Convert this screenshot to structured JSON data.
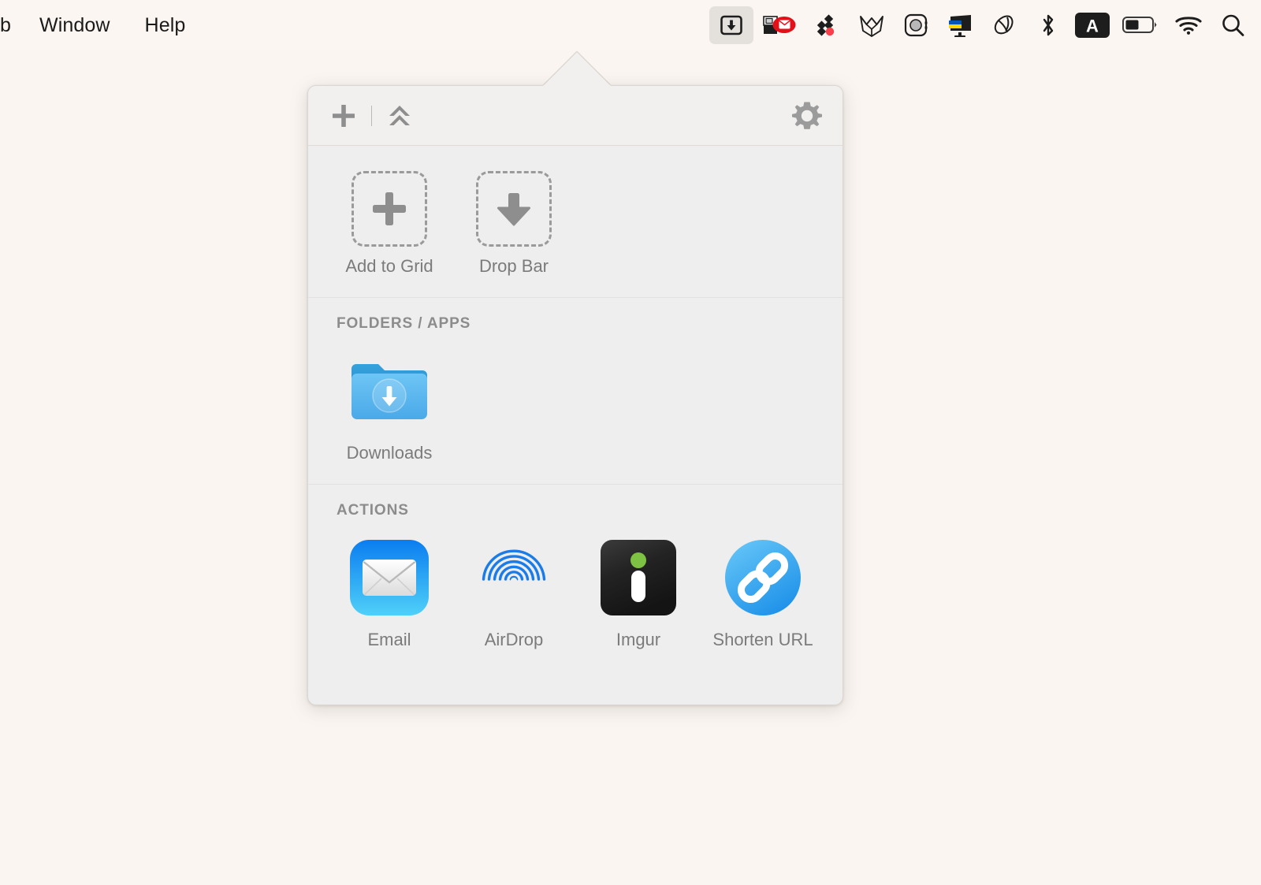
{
  "desktop": {
    "background_color": "#faf5f1"
  },
  "menubar": {
    "background_color": "#fbf6f2",
    "app_menus": [
      {
        "label": "b",
        "name": "menu-clipped",
        "clipped": true
      },
      {
        "label": "Window",
        "name": "menu-window",
        "clipped": false
      },
      {
        "label": "Help",
        "name": "menu-help",
        "clipped": false
      }
    ],
    "status_items": [
      {
        "name": "dropzone-menubar-icon",
        "icon": "download-box-icon",
        "active": true
      },
      {
        "name": "mail-status-icon",
        "icon": "envelope-printer-icon",
        "active": false
      },
      {
        "name": "dropbox-status-icon",
        "icon": "diamonds-dot-icon",
        "active": false
      },
      {
        "name": "firefox-status-icon",
        "icon": "fox-head-icon",
        "active": false
      },
      {
        "name": "camera-status-icon",
        "icon": "camera-circle-icon",
        "active": false
      },
      {
        "name": "flag-status-icon",
        "icon": "ukraine-flag-icon",
        "active": false
      },
      {
        "name": "cleaner-status-icon",
        "icon": "cleaner-brush-icon",
        "active": false
      },
      {
        "name": "bluetooth-status-icon",
        "icon": "bluetooth-icon",
        "active": false
      },
      {
        "name": "keyboard-layout-status-icon",
        "icon": "letter-a-badge-icon",
        "active": false,
        "badge_letter": "A"
      },
      {
        "name": "battery-status-icon",
        "icon": "battery-icon",
        "active": false
      },
      {
        "name": "wifi-status-icon",
        "icon": "wifi-icon",
        "active": false
      },
      {
        "name": "spotlight-status-icon",
        "icon": "search-icon",
        "active": false
      }
    ]
  },
  "popover": {
    "background_color": "#eeeeee",
    "header": {
      "background_color": "#f1f0ef",
      "add_button": {
        "name": "add-grid-button",
        "icon": "plus-icon"
      },
      "collapse_button": {
        "name": "collapse-button",
        "icon": "double-chevron-up-icon"
      },
      "settings_button": {
        "name": "settings-button",
        "icon": "gear-icon"
      }
    },
    "drop_targets": [
      {
        "label": "Add to Grid",
        "icon": "plus-icon",
        "name": "drop-target-add-to-grid"
      },
      {
        "label": "Drop Bar",
        "icon": "arrow-down-icon",
        "name": "drop-target-drop-bar"
      }
    ],
    "sections": [
      {
        "title": "FOLDERS / APPS",
        "name": "section-folders-apps",
        "items": [
          {
            "label": "Downloads",
            "icon": "downloads-folder-icon",
            "name": "item-downloads"
          }
        ]
      },
      {
        "title": "ACTIONS",
        "name": "section-actions",
        "items": [
          {
            "label": "Email",
            "icon": "email-app-icon",
            "name": "item-email"
          },
          {
            "label": "AirDrop",
            "icon": "airdrop-icon",
            "name": "item-airdrop"
          },
          {
            "label": "Imgur",
            "icon": "imgur-icon",
            "name": "item-imgur"
          },
          {
            "label": "Shorten URL",
            "icon": "link-chain-icon",
            "name": "item-shorten-url"
          }
        ]
      }
    ]
  },
  "colors": {
    "label_gray": "#7b7b7b",
    "section_title_gray": "#8c8c8c",
    "icon_gray": "#8a8a8a",
    "accent_blue": "#2196f3",
    "imgur_green": "#7dc242"
  }
}
